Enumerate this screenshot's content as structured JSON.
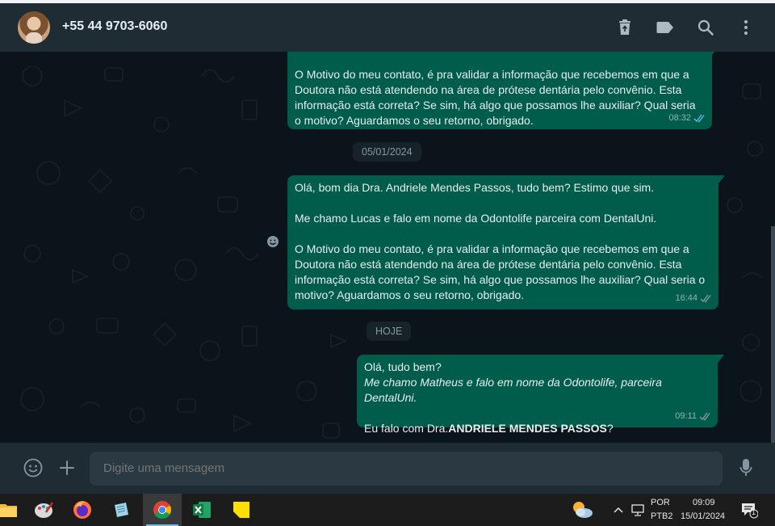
{
  "header": {
    "contact_name": "+55 44 9703-6060",
    "icons": [
      "delete-icon",
      "label-icon",
      "search-icon",
      "menu-icon"
    ]
  },
  "messages": [
    {
      "text": "O Motivo do meu contato, é pra validar a informação que recebemos em que a Doutora não está atendendo na área de prótese dentária pelo convênio. Esta informação está correta? Se sim, há algo que possamos lhe auxiliar? Qual seria o motivo? Aguardamos o seu retorno, obrigado.",
      "time": "08:32",
      "status": "read"
    },
    {
      "text": "Olá, bom dia Dra. Andriele Mendes Passos, tudo bem? Estimo que sim.\n\nMe chamo Lucas e falo em nome da Odontolife parceira com DentalUni.\n\nO Motivo do meu contato, é pra validar a informação que recebemos em que a Doutora não está atendendo na área de prótese dentária pelo convênio. Esta informação está correta? Se sim, há algo que possamos lhe auxiliar? Qual seria o motivo? Aguardamos o seu retorno, obrigado.",
      "time": "16:44",
      "status": "delivered"
    },
    {
      "line1": "Olá, tudo bem?",
      "line2_italic": "Me chamo Matheus e falo em nome da Odontolife, parceira DentalUni.",
      "line3_prefix": "Eu falo com Dra.",
      "line3_bold": "ANDRIELE MENDES PASSOS",
      "line3_suffix": "?",
      "time": "09:11",
      "status": "delivered"
    }
  ],
  "date_separators": {
    "first": "05/01/2024",
    "second": "HOJE"
  },
  "composer": {
    "placeholder": "Digite uma mensagem"
  },
  "taskbar": {
    "apps": [
      "file-explorer",
      "paint",
      "firefox",
      "notepad",
      "chrome",
      "excel",
      "sticky-notes"
    ],
    "active_app": "chrome",
    "language": "POR",
    "keyboard": "PTB2",
    "time": "09:09",
    "date": "15/01/2024",
    "notification_count": "1"
  },
  "colors": {
    "outgoing_bubble": "#005c4b",
    "chat_background": "#0b141a",
    "header": "#202c33",
    "read_ticks": "#53bdeb"
  }
}
